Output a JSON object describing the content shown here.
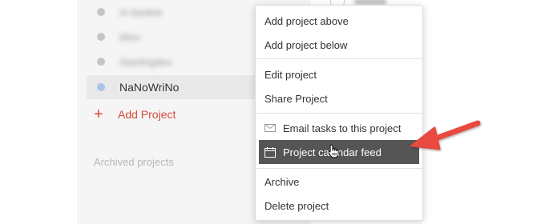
{
  "sidebar": {
    "projects": [
      {
        "label": "In-basket",
        "blurred": true,
        "dot_color": "#c5c5c5"
      },
      {
        "label": "Misc",
        "blurred": true,
        "dot_color": "#c5c5c5"
      },
      {
        "label": "Startingdex",
        "blurred": true,
        "dot_color": "#c5c5c5"
      },
      {
        "label": "NaNoWriNo",
        "blurred": false,
        "dot_color": "#a9c5e6",
        "active": true
      }
    ],
    "add_project_label": "Add Project",
    "add_project_icon": "plus",
    "archived_label": "Archived projects"
  },
  "context_menu": {
    "items": [
      {
        "label": "Add project above"
      },
      {
        "label": "Add project below"
      },
      {
        "label": "Edit project"
      },
      {
        "label": "Share Project"
      },
      {
        "label": "Email tasks to this project",
        "icon": "envelope-icon"
      },
      {
        "label": "Project calendar feed",
        "icon": "calendar-icon",
        "highlighted": true
      },
      {
        "label": "Archive"
      },
      {
        "label": "Delete project"
      }
    ]
  },
  "colors": {
    "accent_red": "#d9493a",
    "menu_highlight": "#555555",
    "arrow_red": "#e8483f",
    "sidebar_bg": "#f5f5f5"
  }
}
